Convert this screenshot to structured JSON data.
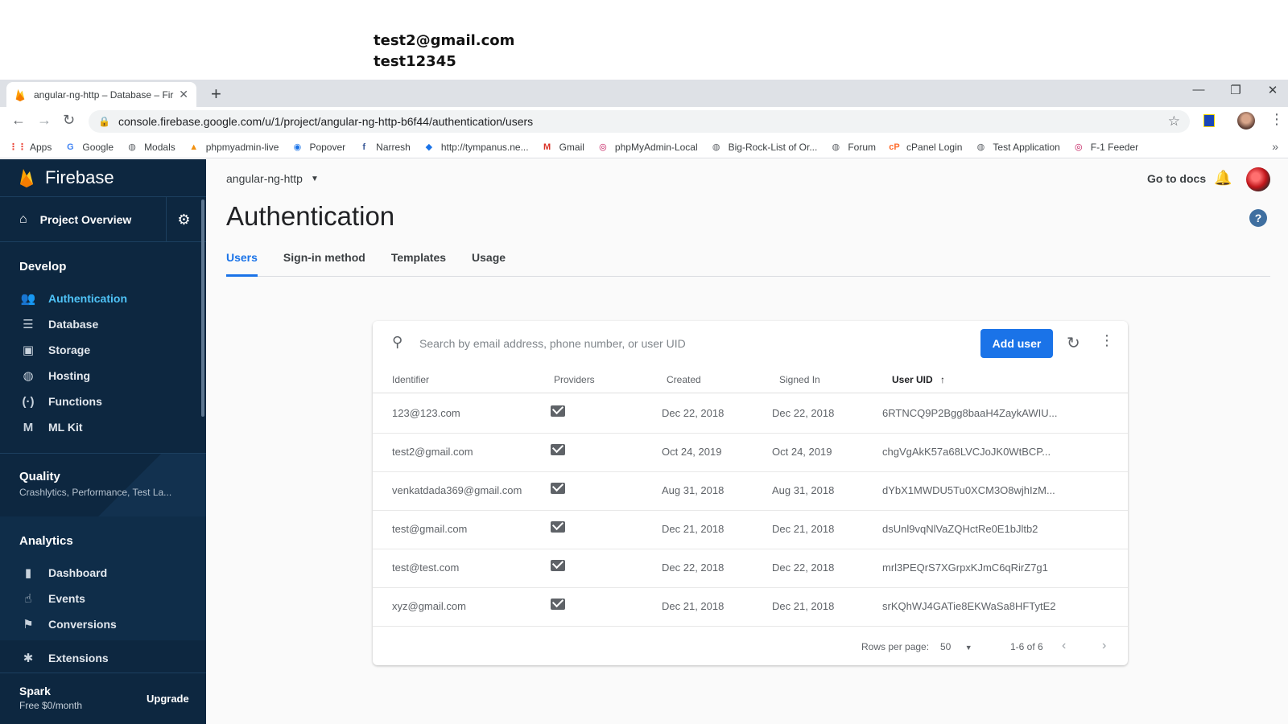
{
  "annotation": {
    "line1": "test2@gmail.com",
    "line2": "test12345"
  },
  "browser": {
    "tab_title": "angular-ng-http – Database – Fir",
    "url": "console.firebase.google.com/u/1/project/angular-ng-http-b6f44/authentication/users",
    "bookmarks": [
      {
        "label": "Apps",
        "icon": "apps-grid-icon",
        "color": "#ea4335"
      },
      {
        "label": "Google",
        "icon": "google-icon",
        "color": "#4285f4"
      },
      {
        "label": "Modals",
        "icon": "globe-icon",
        "color": "#5f6368"
      },
      {
        "label": "phpmyadmin-live",
        "icon": "phpmyadmin-icon",
        "color": "#f29111"
      },
      {
        "label": "Popover",
        "icon": "popover-icon",
        "color": "#1a73e8"
      },
      {
        "label": "Narresh",
        "icon": "facebook-icon",
        "color": "#3b5998"
      },
      {
        "label": "http://tympanus.ne...",
        "icon": "codrops-icon",
        "color": "#1a73e8"
      },
      {
        "label": "Gmail",
        "icon": "gmail-icon",
        "color": "#d93025"
      },
      {
        "label": "phpMyAdmin-Local",
        "icon": "local-icon",
        "color": "#c2185b"
      },
      {
        "label": "Big-Rock-List of Or...",
        "icon": "globe-icon",
        "color": "#5f6368"
      },
      {
        "label": "Forum",
        "icon": "globe-icon",
        "color": "#5f6368"
      },
      {
        "label": "cPanel Login",
        "icon": "cpanel-icon",
        "color": "#ff6c2c"
      },
      {
        "label": "Test Application",
        "icon": "globe-icon",
        "color": "#5f6368"
      },
      {
        "label": "F-1 Feeder",
        "icon": "local-icon",
        "color": "#c2185b"
      }
    ]
  },
  "sidebar": {
    "brand": "Firebase",
    "overview": "Project Overview",
    "develop": {
      "title": "Develop",
      "items": [
        {
          "label": "Authentication",
          "icon": "people-icon",
          "glyph": "👥"
        },
        {
          "label": "Database",
          "icon": "database-icon",
          "glyph": "☰"
        },
        {
          "label": "Storage",
          "icon": "storage-icon",
          "glyph": "▣"
        },
        {
          "label": "Hosting",
          "icon": "globe-icon",
          "glyph": "◍"
        },
        {
          "label": "Functions",
          "icon": "functions-icon",
          "glyph": "(·)"
        },
        {
          "label": "ML Kit",
          "icon": "mlkit-icon",
          "glyph": "M"
        }
      ]
    },
    "quality": {
      "title": "Quality",
      "subtitle": "Crashlytics, Performance, Test La..."
    },
    "analytics": {
      "title": "Analytics",
      "items": [
        {
          "label": "Dashboard",
          "icon": "bar-chart-icon",
          "glyph": "▮"
        },
        {
          "label": "Events",
          "icon": "touch-icon",
          "glyph": "☝"
        },
        {
          "label": "Conversions",
          "icon": "flag-icon",
          "glyph": "⚑"
        }
      ]
    },
    "extensions": {
      "label": "Extensions",
      "icon": "extensions-icon",
      "glyph": "✱"
    },
    "plan": {
      "name": "Spark",
      "price": "Free $0/month",
      "upgrade": "Upgrade"
    }
  },
  "header": {
    "project": "angular-ng-http",
    "docs": "Go to docs"
  },
  "page": {
    "title": "Authentication",
    "tabs": [
      "Users",
      "Sign-in method",
      "Templates",
      "Usage"
    ],
    "active_tab": "Users"
  },
  "users_table": {
    "search_placeholder": "Search by email address, phone number, or user UID",
    "add_button": "Add user",
    "columns": [
      "Identifier",
      "Providers",
      "Created",
      "Signed In",
      "User UID"
    ],
    "sorted_column": "User UID",
    "rows": [
      {
        "identifier": "123@123.com",
        "provider": "email-icon",
        "created": "Dec 22, 2018",
        "signed_in": "Dec 22, 2018",
        "uid": "6RTNCQ9P2Bgg8baaH4ZaykAWIU..."
      },
      {
        "identifier": "test2@gmail.com",
        "provider": "email-icon",
        "created": "Oct 24, 2019",
        "signed_in": "Oct 24, 2019",
        "uid": "chgVgAkK57a68LVCJoJK0WtBCP..."
      },
      {
        "identifier": "venkatdada369@gmail.com",
        "provider": "email-icon",
        "created": "Aug 31, 2018",
        "signed_in": "Aug 31, 2018",
        "uid": "dYbX1MWDU5Tu0XCM3O8wjhIzM..."
      },
      {
        "identifier": "test@gmail.com",
        "provider": "email-icon",
        "created": "Dec 21, 2018",
        "signed_in": "Dec 21, 2018",
        "uid": "dsUnl9vqNlVaZQHctRe0E1bJltb2"
      },
      {
        "identifier": "test@test.com",
        "provider": "email-icon",
        "created": "Dec 22, 2018",
        "signed_in": "Dec 22, 2018",
        "uid": "mrl3PEQrS7XGrpxKJmC6qRirZ7g1"
      },
      {
        "identifier": "xyz@gmail.com",
        "provider": "email-icon",
        "created": "Dec 21, 2018",
        "signed_in": "Dec 21, 2018",
        "uid": "srKQhWJ4GATie8EKWaSa8HFTytE2"
      }
    ],
    "rows_per_page_label": "Rows per page:",
    "rows_per_page": "50",
    "range": "1-6 of 6"
  },
  "colors": {
    "accent": "#1a73e8",
    "sidebar_bg": "#0d2740",
    "active_nav": "#4fc3f7"
  }
}
